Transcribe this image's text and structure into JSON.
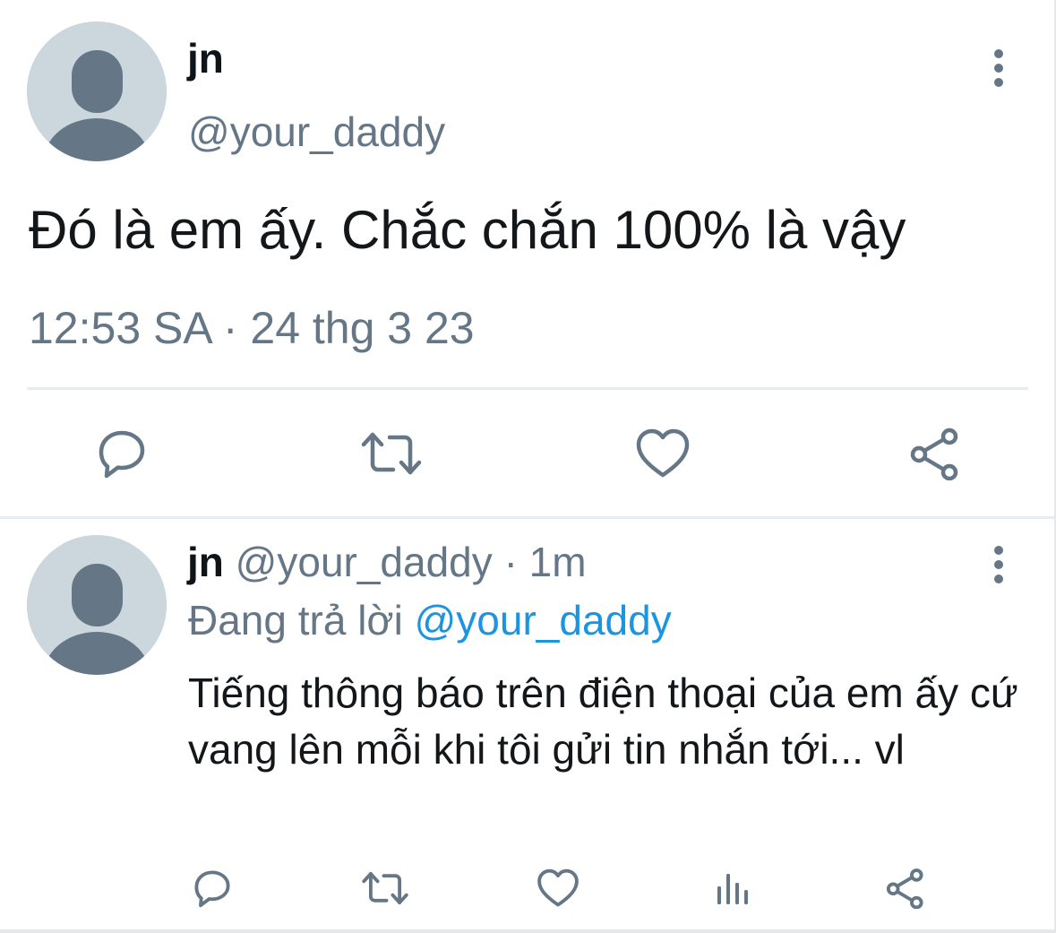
{
  "main_tweet": {
    "display_name": "jn",
    "handle": "@your_daddy",
    "text": "Đó là em ấy. Chắc chắn 100% là vậy",
    "timestamp": "12:53 SA · 24 thg 3 23",
    "actions": [
      "reply-icon",
      "retweet-icon",
      "like-icon",
      "share-icon"
    ]
  },
  "reply_tweet": {
    "display_name": "jn",
    "handle": "@your_daddy",
    "separator": "·",
    "time_ago": "1m",
    "replying_prefix": "Đang trả lời",
    "replying_to": "@your_daddy",
    "text": "Tiếng thông báo trên điện thoại của em ấy cứ vang lên mỗi khi tôi gửi tin nhắn tới... vl",
    "actions": [
      "reply-icon",
      "retweet-icon",
      "like-icon",
      "analytics-icon",
      "share-icon"
    ]
  },
  "colors": {
    "text_primary": "#0f1419",
    "text_secondary": "#657786",
    "link": "#1b95e0",
    "avatar_bg": "#ccd6dd",
    "avatar_fg": "#657786",
    "divider": "#e6ecf0"
  }
}
